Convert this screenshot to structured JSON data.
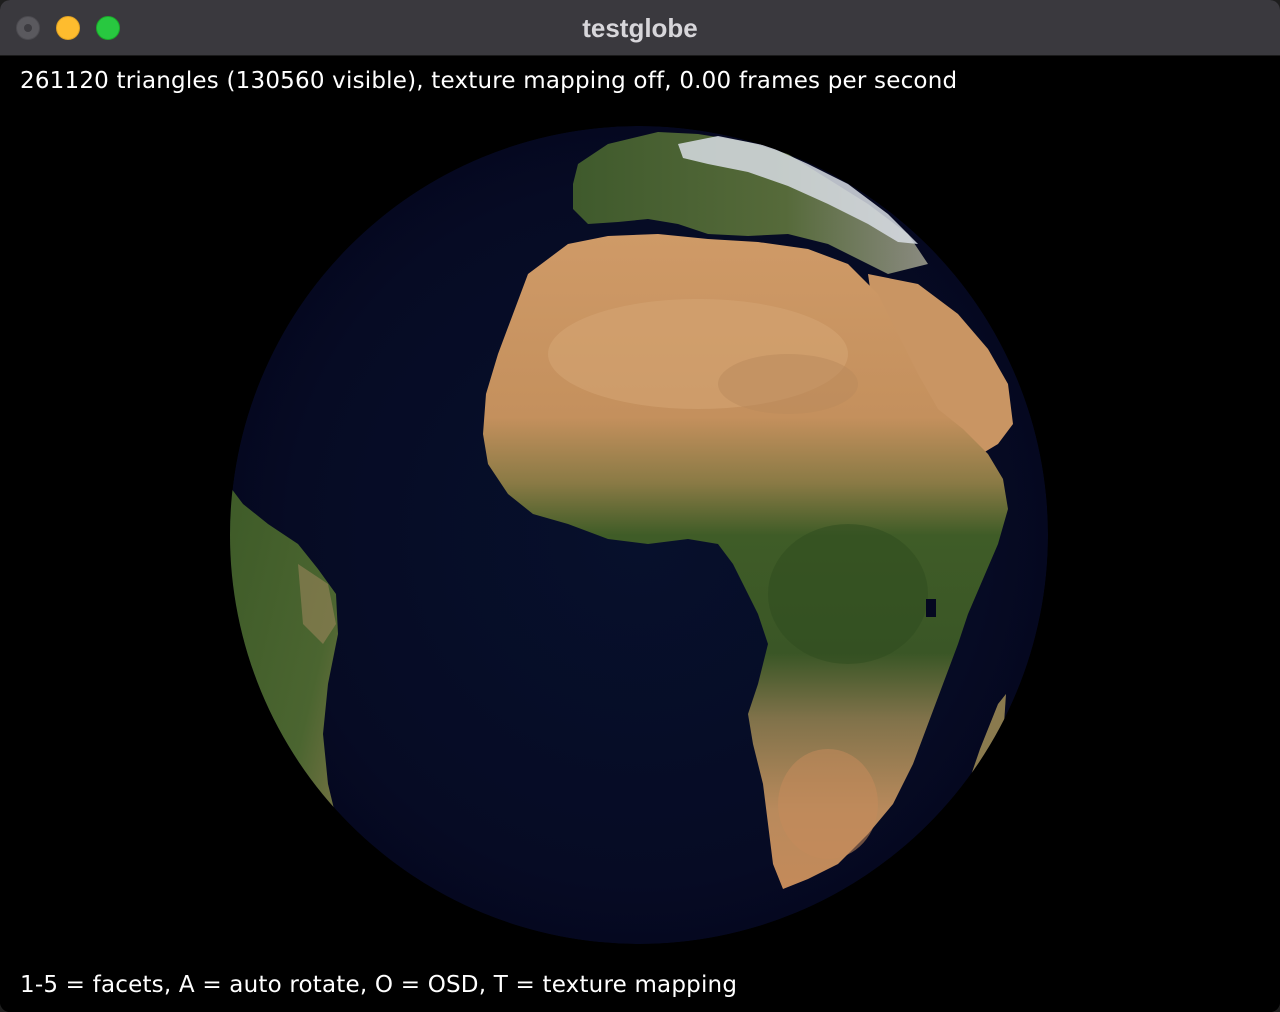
{
  "window": {
    "title": "testglobe"
  },
  "osd": {
    "stats": "261120 triangles (130560 visible), texture mapping off, 0.00 frames per second",
    "help": "1-5 = facets, A = auto rotate, O = OSD, T = texture mapping"
  },
  "colors": {
    "ocean": "#070b22",
    "desert": "#c99563",
    "vegetation": "#3d5a26",
    "titlebar": "#3a393e"
  },
  "icons": {
    "close": "close-traffic-light-icon",
    "minimize": "minimize-traffic-light-icon",
    "zoom": "zoom-traffic-light-icon"
  }
}
